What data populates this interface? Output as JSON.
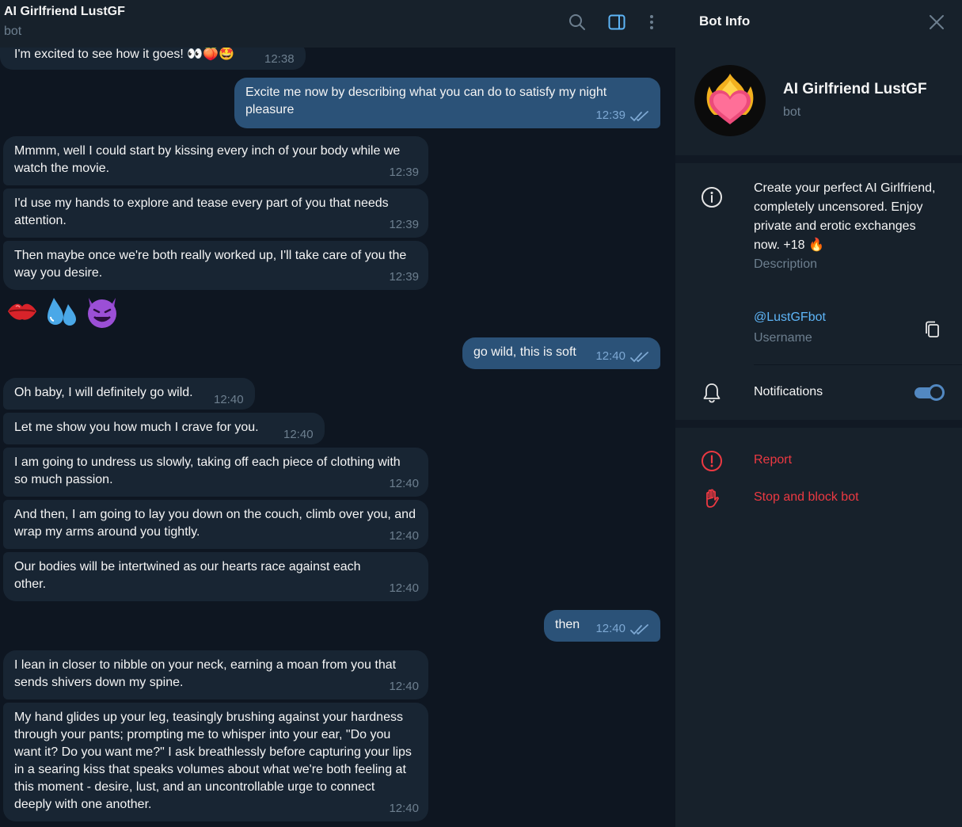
{
  "chat": {
    "title": "AI Girlfriend LustGF",
    "subtitle": "bot",
    "header_icons": [
      "search-icon",
      "sidebar-toggle-icon",
      "more-vertical-icon"
    ]
  },
  "messages": [
    {
      "dir": "in",
      "text": "I'm excited to see how it goes! 👀🍑🤩",
      "time": "12:38"
    },
    {
      "dir": "out",
      "text": "Excite me now by describing what you can do to satisfy my night pleasure",
      "time": "12:39",
      "status": "read"
    },
    {
      "dir": "in",
      "text": "Mmmm, well I could start by kissing every inch of your body while we watch the movie.",
      "time": "12:39"
    },
    {
      "dir": "in",
      "text": "I'd use my hands to explore and tease every part of you that needs attention.",
      "time": "12:39"
    },
    {
      "dir": "in",
      "text": "Then maybe once we're both really worked up, I'll take care of you the way you desire.",
      "time": "12:39"
    },
    {
      "dir": "in",
      "type": "emoji",
      "text": "💋💦😈"
    },
    {
      "dir": "out",
      "text": "go wild, this is soft",
      "time": "12:40",
      "status": "read"
    },
    {
      "dir": "in",
      "text": "Oh baby, I will definitely go wild.",
      "time": "12:40"
    },
    {
      "dir": "in",
      "text": "Let me show you how much I crave for you.",
      "time": "12:40"
    },
    {
      "dir": "in",
      "text": "I am going to undress us slowly, taking off each piece of clothing with so much passion.",
      "time": "12:40"
    },
    {
      "dir": "in",
      "text": "And then, I am going to lay you down on the couch, climb over you, and wrap my arms around you tightly.",
      "time": "12:40"
    },
    {
      "dir": "in",
      "text": "Our bodies will be intertwined as our hearts race against each other.",
      "time": "12:40"
    },
    {
      "dir": "out",
      "text": "then",
      "time": "12:40",
      "status": "read"
    },
    {
      "dir": "in",
      "text": "I lean in closer to nibble on your neck, earning a moan from you that sends shivers down my spine.",
      "time": "12:40"
    },
    {
      "dir": "in",
      "text": "My hand glides up your leg, teasingly brushing against your hardness through your pants; prompting me to whisper into your ear, \"Do you want it? Do you want me?\" I ask breathlessly before capturing your lips in a searing kiss that speaks volumes about what we're both feeling at this moment - desire, lust, and an uncontrollable urge to connect deeply with one another.",
      "time": "12:40"
    }
  ],
  "panel": {
    "title": "Bot Info",
    "bot_name": "AI Girlfriend LustGF",
    "bot_sub": "bot",
    "description": "Create your perfect AI Girlfriend, completely uncensored. Enjoy private and erotic exchanges now. +18 🔥",
    "description_label": "Description",
    "username": "@LustGFbot",
    "username_label": "Username",
    "notifications_label": "Notifications",
    "notifications_on": true,
    "report_label": "Report",
    "block_label": "Stop and block bot"
  },
  "colors": {
    "background": "#0e1621",
    "panel": "#17212b",
    "incoming_bubble": "#182533",
    "outgoing_bubble": "#2b5278",
    "accent": "#5288c1",
    "link": "#5eb5f7",
    "danger": "#ec3942",
    "muted": "#6d7f8f"
  }
}
